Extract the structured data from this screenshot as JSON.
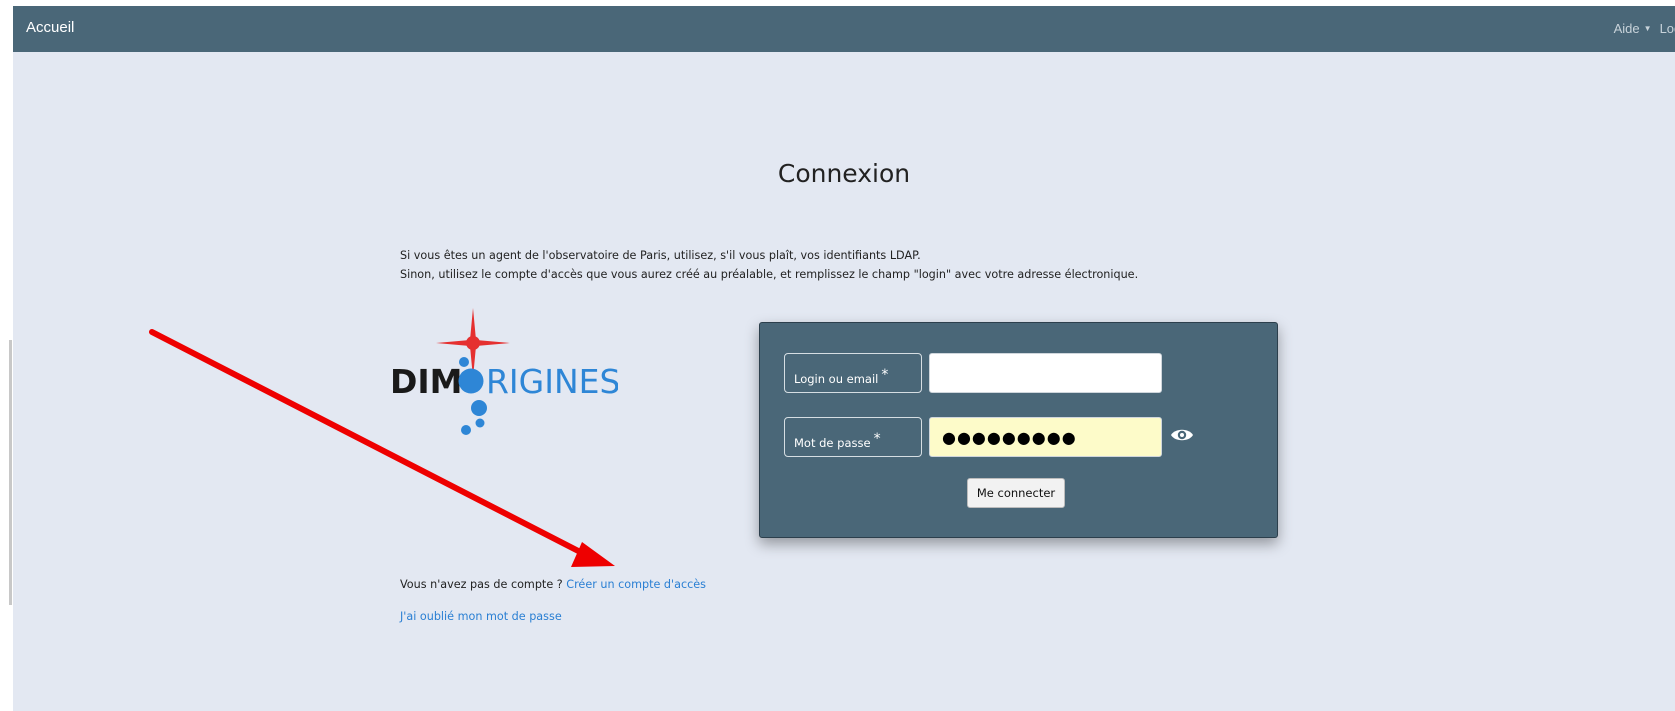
{
  "navbar": {
    "brand": "Accueil",
    "help_label": "Aide",
    "login_label": "Log in"
  },
  "page": {
    "title": "Connexion",
    "intro_line1": "Si vous êtes un agent de l'observatoire de Paris, utilisez, s'il vous plaît, vos identifiants LDAP.",
    "intro_line2": "Sinon, utilisez le compte d'accès que vous aurez créé au préalable, et remplissez le champ \"login\" avec votre adresse électronique."
  },
  "logo": {
    "text_left": "DIM",
    "text_right": "RIGINES"
  },
  "form": {
    "login_label": "Login ou email",
    "login_value": "",
    "password_label": "Mot de passe",
    "password_value": "●●●●●●●●●",
    "required_mark": "*",
    "submit_label": "Me connecter"
  },
  "links": {
    "no_account_text": "Vous n'avez pas de compte ?",
    "create_account": "Créer un compte d'accès",
    "forgot_password": "J'ai oublié mon mot de passe"
  },
  "colors": {
    "navbar_bg": "#4a6778",
    "page_bg": "#e3e8f2",
    "link": "#2a7fd3",
    "annotation_arrow": "#ee0000",
    "logo_blue": "#2e86d6"
  }
}
